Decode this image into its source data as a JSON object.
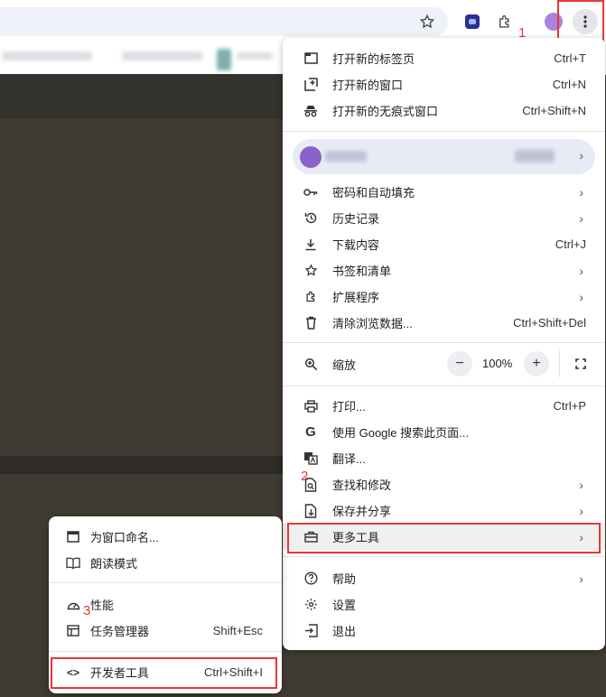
{
  "colors": {
    "annotation_red": "#e53935",
    "page_bg": "#3f3b32",
    "profile_bg": "#e8eaf6",
    "hover_bg": "#f0f0f0"
  },
  "toolbar": {
    "icons": [
      "star-icon",
      "extension-app-icon",
      "puzzle-icon",
      "avatar",
      "more-vert-icon"
    ]
  },
  "annotations": {
    "one": "1",
    "two": "2",
    "three": "3"
  },
  "menu": {
    "new_tab": {
      "label": "打开新的标签页",
      "shortcut": "Ctrl+T"
    },
    "new_window": {
      "label": "打开新的窗口",
      "shortcut": "Ctrl+N"
    },
    "incognito": {
      "label": "打开新的无痕式窗口",
      "shortcut": "Ctrl+Shift+N"
    },
    "passwords": {
      "label": "密码和自动填充"
    },
    "history": {
      "label": "历史记录"
    },
    "downloads": {
      "label": "下载内容",
      "shortcut": "Ctrl+J"
    },
    "bookmarks": {
      "label": "书签和清单"
    },
    "extensions": {
      "label": "扩展程序"
    },
    "clear_data": {
      "label": "清除浏览数据...",
      "shortcut": "Ctrl+Shift+Del"
    },
    "zoom": {
      "label": "缩放",
      "minus": "−",
      "value": "100%",
      "plus": "+"
    },
    "print": {
      "label": "打印...",
      "shortcut": "Ctrl+P"
    },
    "search_google": {
      "label": "使用 Google 搜索此页面..."
    },
    "translate": {
      "label": "翻译..."
    },
    "find_edit": {
      "label": "查找和修改"
    },
    "save_share": {
      "label": "保存并分享"
    },
    "more_tools": {
      "label": "更多工具"
    },
    "help": {
      "label": "帮助"
    },
    "settings": {
      "label": "设置"
    },
    "exit": {
      "label": "退出"
    }
  },
  "submenu": {
    "name_window": {
      "label": "为窗口命名..."
    },
    "reading_mode": {
      "label": "朗读模式"
    },
    "performance": {
      "label": "性能"
    },
    "task_manager": {
      "label": "任务管理器",
      "shortcut": "Shift+Esc"
    },
    "dev_tools": {
      "label": "开发者工具",
      "shortcut": "Ctrl+Shift+I"
    }
  }
}
